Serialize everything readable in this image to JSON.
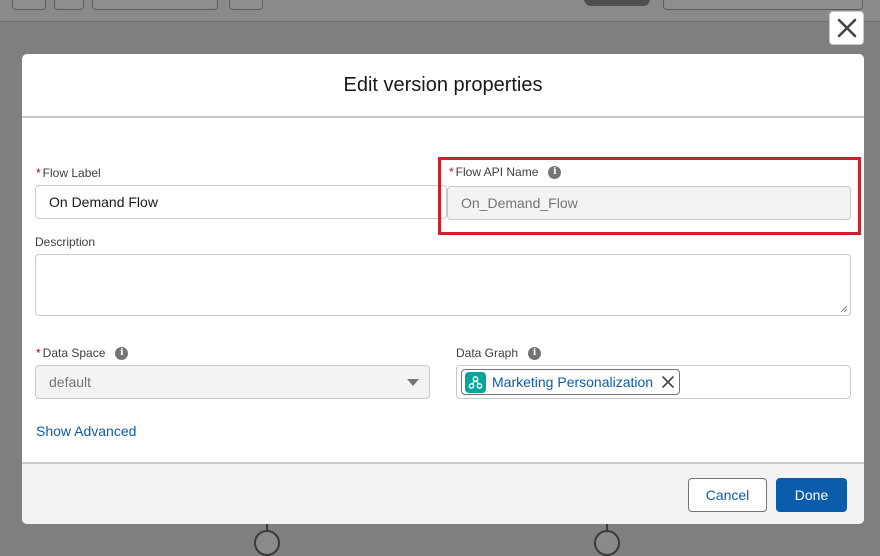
{
  "dialog": {
    "title": "Edit version properties",
    "close_icon": "close-icon"
  },
  "fields": {
    "flow_label": {
      "label": "Flow Label",
      "required": "*",
      "value": "On Demand Flow"
    },
    "flow_api_name": {
      "label": "Flow API Name",
      "required": "*",
      "value": "On_Demand_Flow",
      "info_icon": "info-icon"
    },
    "description": {
      "label": "Description",
      "value": ""
    },
    "data_space": {
      "label": "Data Space",
      "required": "*",
      "value": "default",
      "info_icon": "info-icon"
    },
    "data_graph": {
      "label": "Data Graph",
      "info_icon": "info-icon",
      "selected": "Marketing Personalization",
      "pill_icon": "data-graph-icon"
    }
  },
  "links": {
    "show_advanced": "Show Advanced"
  },
  "footer": {
    "cancel_label": "Cancel",
    "done_label": "Done"
  },
  "colors": {
    "brand": "#0b5cab",
    "required": "#ba0517",
    "highlight": "#d0202f",
    "pill_icon_bg": "#06a59a"
  }
}
